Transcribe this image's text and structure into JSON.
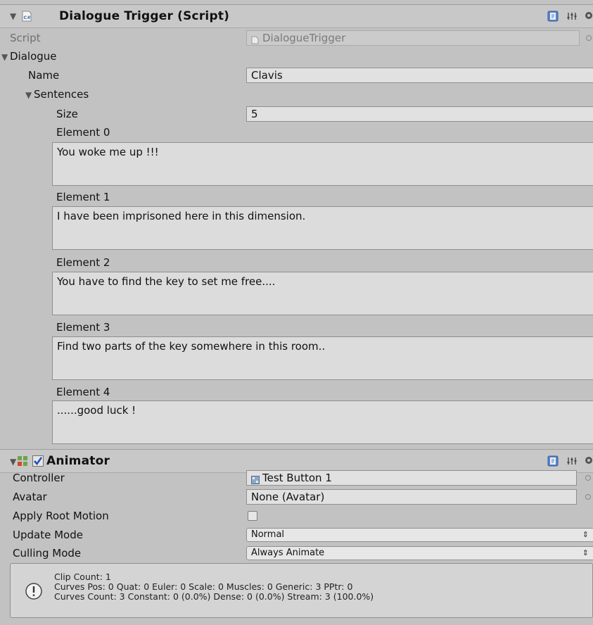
{
  "dialogue_trigger": {
    "title": "Dialogue Trigger (Script)",
    "script_label": "Script",
    "script_value": "DialogueTrigger",
    "dialogue_label": "Dialogue",
    "name_label": "Name",
    "name_value": "Clavis",
    "sentences_label": "Sentences",
    "size_label": "Size",
    "size_value": "5",
    "elements": [
      {
        "label": "Element 0",
        "text": "You woke me up !!!"
      },
      {
        "label": "Element 1",
        "text": "I have been imprisoned here in this dimension."
      },
      {
        "label": "Element 2",
        "text": "You have to find the key to set me free...."
      },
      {
        "label": "Element 3",
        "text": "Find two parts of the key somewhere in this room.."
      },
      {
        "label": "Element 4",
        "text": "......good luck !"
      }
    ]
  },
  "animator": {
    "title": "Animator",
    "enabled": true,
    "controller_label": "Controller",
    "controller_value": "Test Button 1",
    "avatar_label": "Avatar",
    "avatar_value": "None (Avatar)",
    "apply_root_motion_label": "Apply Root Motion",
    "apply_root_motion_checked": false,
    "update_mode_label": "Update Mode",
    "update_mode_value": "Normal",
    "culling_mode_label": "Culling Mode",
    "culling_mode_value": "Always Animate"
  },
  "info_box": {
    "line1": "Clip Count: 1",
    "line2": "Curves Pos: 0 Quat: 0 Euler: 0 Scale: 0 Muscles: 0 Generic: 3 PPtr: 0",
    "line3": "Curves Count: 3 Constant: 0 (0.0%) Dense: 0 (0.0%) Stream: 3 (100.0%)"
  },
  "colors": {
    "panel_bg": "#c2c2c2",
    "header_bg": "#c8c8c8",
    "field_bg": "#e1e1e1",
    "field_border": "#8f8f8f",
    "check_blue": "#1f4fb4"
  },
  "icons": {
    "script_icon": "csharp-script-icon",
    "animator_icon": "animator-icon",
    "help_icon": "book-help-icon",
    "settings_icon": "gear-icon",
    "info_icon": "exclamation-info-icon"
  }
}
